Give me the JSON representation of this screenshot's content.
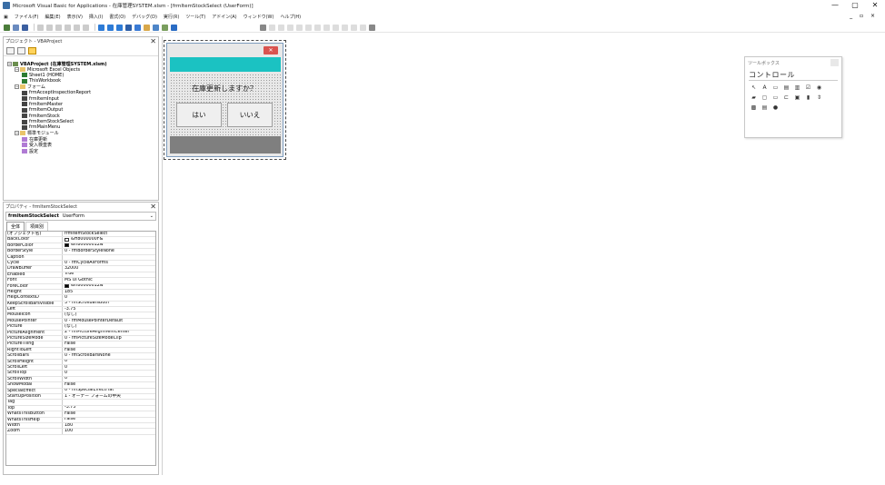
{
  "window": {
    "title": "Microsoft Visual Basic for Applications - 在庫管理SYSTEM.xlsm - [frmItemStockSelect (UserForm)]",
    "min_label": "—",
    "max_label": "▢",
    "close_label": "✕",
    "mdi_controls": "_ ▫ ×"
  },
  "menubar": {
    "items": [
      {
        "label": "ファイル(F)"
      },
      {
        "label": "編集(E)"
      },
      {
        "label": "表示(V)"
      },
      {
        "label": "挿入(I)"
      },
      {
        "label": "書式(O)"
      },
      {
        "label": "デバッグ(D)"
      },
      {
        "label": "実行(R)"
      },
      {
        "label": "ツール(T)"
      },
      {
        "label": "アドイン(A)"
      },
      {
        "label": "ウィンドウ(W)"
      },
      {
        "label": "ヘルプ(H)"
      }
    ]
  },
  "project_explorer": {
    "title": "プロジェクト - VBAProject",
    "close": "✕",
    "tree": [
      {
        "label": "VBAProject (在庫管理SYSTEM.xlsm)",
        "type": "vba",
        "indent": 0,
        "bold": true,
        "toggle": "−"
      },
      {
        "label": "Microsoft Excel Objects",
        "type": "folder",
        "indent": 1,
        "toggle": "−"
      },
      {
        "label": "Sheet1 (HOME)",
        "type": "sheet",
        "indent": 2
      },
      {
        "label": "ThisWorkbook",
        "type": "sheet",
        "indent": 2
      },
      {
        "label": "フォーム",
        "type": "folder",
        "indent": 1,
        "toggle": "−"
      },
      {
        "label": "frmAcceptInspectionReport",
        "type": "form",
        "indent": 2
      },
      {
        "label": "frmItemInput",
        "type": "form",
        "indent": 2
      },
      {
        "label": "frmItemMaster",
        "type": "form",
        "indent": 2
      },
      {
        "label": "frmItemOutput",
        "type": "form",
        "indent": 2
      },
      {
        "label": "frmItemStock",
        "type": "form",
        "indent": 2
      },
      {
        "label": "frmItemStockSelect",
        "type": "form",
        "indent": 2
      },
      {
        "label": "frmMainMenu",
        "type": "form",
        "indent": 2
      },
      {
        "label": "標準モジュール",
        "type": "folder",
        "indent": 1,
        "toggle": "−"
      },
      {
        "label": "在庫更新",
        "type": "mod",
        "indent": 2
      },
      {
        "label": "受入検査表",
        "type": "mod",
        "indent": 2
      },
      {
        "label": "設定",
        "type": "mod",
        "indent": 2
      }
    ]
  },
  "properties": {
    "title": "プロパティ - frmItemStockSelect",
    "close": "✕",
    "object_name": "frmItemStockSelect",
    "object_type": "UserForm",
    "tabs": [
      "全体",
      "項目別"
    ],
    "rows": [
      {
        "name": "(オブジェクト名)",
        "value": "frmItemStockSelect"
      },
      {
        "name": "BackColor",
        "value": "&H8000000F&",
        "swatch": "#ffffff"
      },
      {
        "name": "BorderColor",
        "value": "&H80000012&",
        "swatch": "#000000"
      },
      {
        "name": "BorderStyle",
        "value": "0 - fmBorderStyleNone"
      },
      {
        "name": "Caption",
        "value": ""
      },
      {
        "name": "Cycle",
        "value": "0 - fmCycleAllForms"
      },
      {
        "name": "DrawBuffer",
        "value": "32000"
      },
      {
        "name": "Enabled",
        "value": "True"
      },
      {
        "name": "Font",
        "value": "MS UI Gothic"
      },
      {
        "name": "ForeColor",
        "value": "&H80000012&",
        "swatch": "#000000"
      },
      {
        "name": "Height",
        "value": "185"
      },
      {
        "name": "HelpContextID",
        "value": "0"
      },
      {
        "name": "KeepScrollBarsVisible",
        "value": "3 - fmScrollBarsBoth"
      },
      {
        "name": "Left",
        "value": "-3.75"
      },
      {
        "name": "MouseIcon",
        "value": "(なし)"
      },
      {
        "name": "MousePointer",
        "value": "0 - fmMousePointerDefault"
      },
      {
        "name": "Picture",
        "value": "(なし)"
      },
      {
        "name": "PictureAlignment",
        "value": "2 - fmPictureAlignmentCenter"
      },
      {
        "name": "PictureSizeMode",
        "value": "0 - fmPictureSizeModeClip"
      },
      {
        "name": "PictureTiling",
        "value": "False"
      },
      {
        "name": "RightToLeft",
        "value": "False"
      },
      {
        "name": "ScrollBars",
        "value": "0 - fmScrollBarsNone"
      },
      {
        "name": "ScrollHeight",
        "value": "0"
      },
      {
        "name": "ScrollLeft",
        "value": "0"
      },
      {
        "name": "ScrollTop",
        "value": "0"
      },
      {
        "name": "ScrollWidth",
        "value": "0"
      },
      {
        "name": "ShowModal",
        "value": "False"
      },
      {
        "name": "SpecialEffect",
        "value": "0 - fmSpecialEffectFlat"
      },
      {
        "name": "StartUpPosition",
        "value": "1 - オーナー フォームの中央"
      },
      {
        "name": "Tag",
        "value": ""
      },
      {
        "name": "Top",
        "value": "-3.75"
      },
      {
        "name": "WhatsThisButton",
        "value": "False"
      },
      {
        "name": "WhatsThisHelp",
        "value": "False"
      },
      {
        "name": "Width",
        "value": "180"
      },
      {
        "name": "Zoom",
        "value": "100"
      }
    ]
  },
  "userform": {
    "close": "✕",
    "question": "在庫更新しますか？",
    "yes_label": "はい",
    "no_label": "いいえ",
    "accent_color": "#1bc2c2"
  },
  "toolbox": {
    "title": "ツールボックス",
    "tab": "コントロール",
    "icons": [
      "pointer-icon",
      "label-icon",
      "textbox-icon",
      "combobox-icon",
      "listbox-icon",
      "checkbox-icon",
      "optionbutton-icon",
      "togglebutton-icon",
      "frame-icon",
      "commandbutton-icon",
      "tabstrip-icon",
      "multipage-icon",
      "scrollbar-icon",
      "spinbutton-icon",
      "image-icon",
      "refedit-icon",
      "globe-icon"
    ],
    "glyphs": [
      "↖",
      "A",
      "▭",
      "▤",
      "▥",
      "☑",
      "◉",
      "▰",
      "▢",
      "▭",
      "⊏",
      "▣",
      "▮",
      "⇕",
      "▩",
      "▤",
      "●"
    ]
  }
}
